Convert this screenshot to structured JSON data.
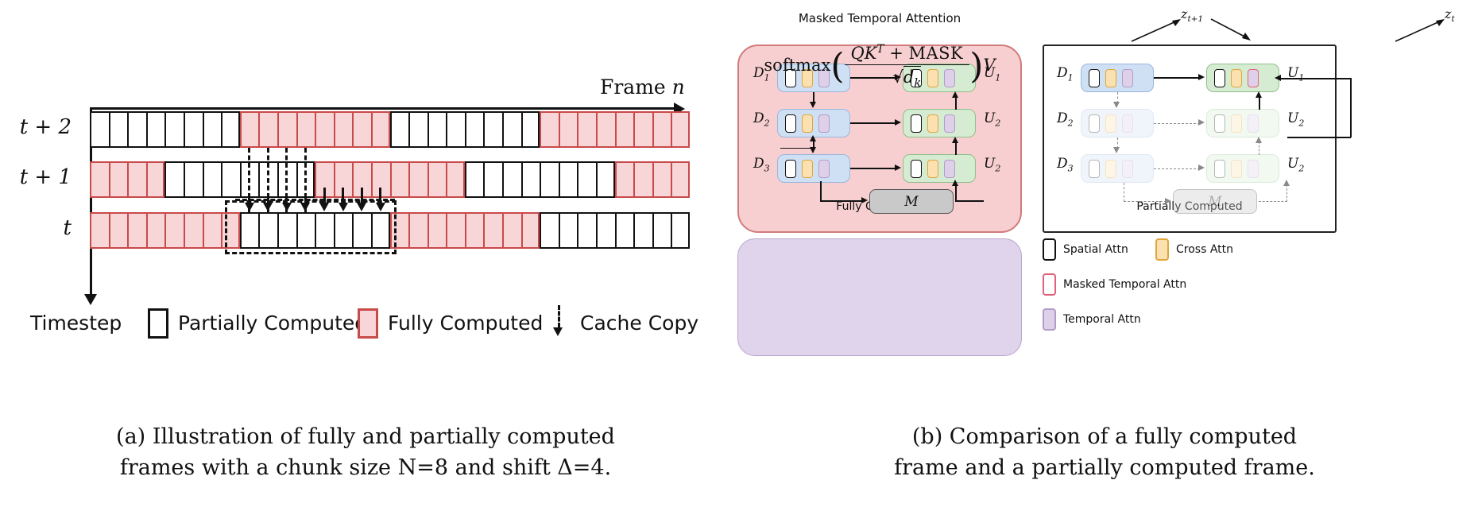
{
  "figure": {
    "panel_a": {
      "axis": {
        "x_label": "Frame",
        "x_label_var": "n",
        "y_label": "Timestep"
      },
      "row_labels": [
        "t + 2",
        "t + 1",
        "t"
      ],
      "rows": [
        {
          "label": "t + 2",
          "segments": [
            {
              "state": "partial",
              "count": 8
            },
            {
              "state": "full",
              "count": 8
            },
            {
              "state": "partial",
              "count": 8
            },
            {
              "state": "full",
              "count": 8
            }
          ]
        },
        {
          "label": "t + 1",
          "segments": [
            {
              "state": "full",
              "count": 4
            },
            {
              "state": "partial",
              "count": 8
            },
            {
              "state": "full",
              "count": 8
            },
            {
              "state": "partial",
              "count": 8
            },
            {
              "state": "full",
              "count": 4
            }
          ]
        },
        {
          "label": "t",
          "segments": [
            {
              "state": "full",
              "count": 8
            },
            {
              "state": "partial",
              "count": 8
            },
            {
              "state": "full",
              "count": 8
            },
            {
              "state": "partial",
              "count": 8
            }
          ]
        }
      ],
      "legend": [
        {
          "swatch": "partial",
          "label": "Partially Computed"
        },
        {
          "swatch": "full",
          "label": "Fully Computed"
        },
        {
          "swatch": "dashed-arrow",
          "label": "Cache Copy"
        }
      ],
      "caption_line1": "(a) Illustration of fully and partially computed",
      "caption_line2": "frames with a chunk size N=8 and shift Δ=4."
    },
    "panel_b": {
      "z_labels": [
        "z",
        "z"
      ],
      "z_sub": [
        "t+1",
        "t"
      ],
      "fully_computed": {
        "title": "Fully Computed",
        "input_labels": [
          "D",
          "D",
          "D"
        ],
        "input_subs": [
          "1",
          "2",
          "3"
        ],
        "output_labels": [
          "U",
          "U",
          "U"
        ],
        "output_subs": [
          "1",
          "2",
          "2"
        ],
        "mask_label": "M"
      },
      "partially_computed": {
        "title": "Partially Computed",
        "input_labels": [
          "D",
          "D",
          "D"
        ],
        "input_subs": [
          "1",
          "2",
          "3"
        ],
        "output_labels": [
          "U",
          "U",
          "U"
        ],
        "output_subs": [
          "1",
          "2",
          "2"
        ],
        "mask_label": "M"
      },
      "legend": [
        {
          "key": "spatial",
          "label": "Spatial Attn"
        },
        {
          "key": "cross",
          "label": "Cross Attn"
        },
        {
          "key": "masked",
          "label": "Masked Temporal Attn"
        },
        {
          "key": "temporal",
          "label": "Temporal Attn"
        }
      ],
      "formula_box": {
        "title": "Masked Temporal Attention",
        "softmax": "softmax",
        "numerator": "QK",
        "numerator_sup": "T",
        "numerator_plus": "+",
        "numerator_mask": "MASK",
        "denominator_sqrt": "√",
        "denominator_var": "d",
        "denominator_sub": "k",
        "tail": "V"
      },
      "caption_line1": "(b) Comparison of a fully computed",
      "caption_line2": "frame and a partially computed frame."
    }
  },
  "colors": {
    "full_fill": "#f8d5d6",
    "full_border": "#c94a4a",
    "partial_fill": "#ffffff",
    "partial_border": "#111111",
    "group_full_bg": "#f8cfd0",
    "group_full_border": "#d07b7b",
    "block_down_bg": "#cfe0f4",
    "block_up_bg": "#d6ecd2",
    "token_cross": "#fbe1b0",
    "token_temporal": "#ddd0e8",
    "token_masked_border": "#e2607a",
    "mask_box": "#c9c9c9",
    "formula_bg": "#e0d4ec"
  }
}
